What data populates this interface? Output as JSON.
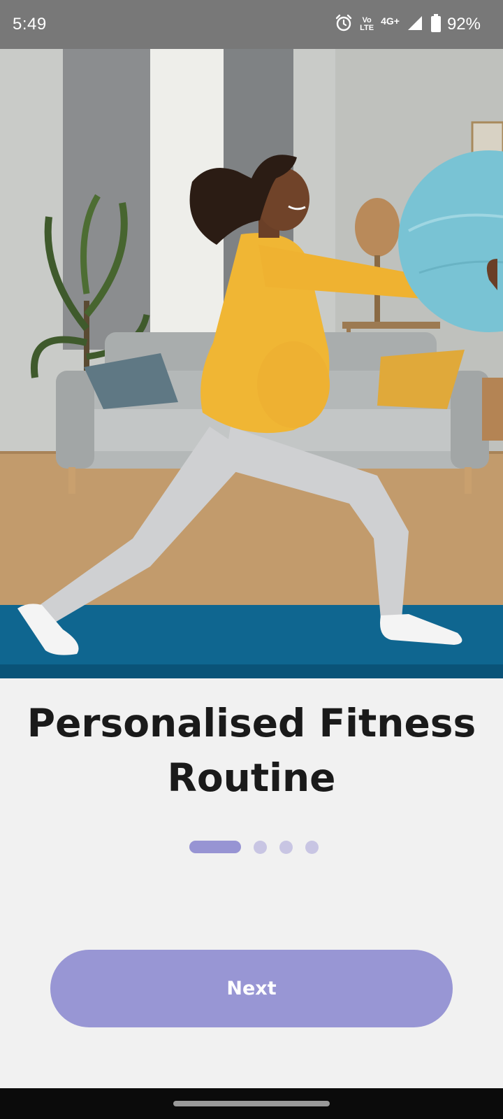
{
  "status_bar": {
    "time": "5:49",
    "volte_top": "Vo",
    "volte_bottom": "LTE",
    "network": "4G+",
    "battery": "92%",
    "icons": [
      "alarm-icon",
      "volte-icon",
      "signal-icon",
      "battery-icon"
    ]
  },
  "hero": {
    "image": "pregnant-woman-exercise-ball-photo"
  },
  "onboarding": {
    "title_line1": "Personalised Fitness",
    "title_line2": "Routine",
    "page_indicator": {
      "total": 4,
      "current": 1
    },
    "next_label": "Next"
  },
  "colors": {
    "accent": "#9896d4",
    "dot_inactive": "#c8c5e3",
    "background": "#f1f1f1"
  }
}
